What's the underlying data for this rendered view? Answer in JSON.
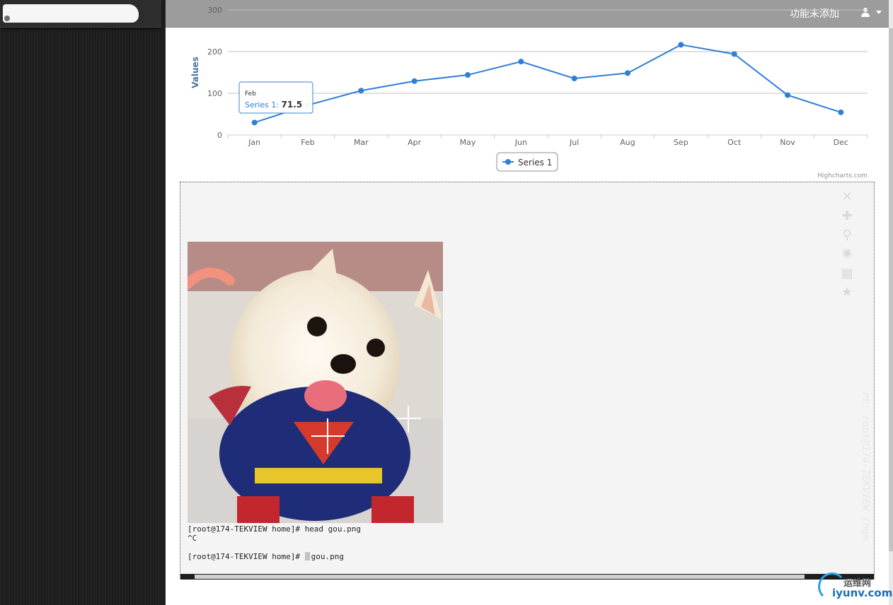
{
  "header": {
    "feature_label": "功能未添加"
  },
  "chart_data": {
    "type": "line",
    "categories": [
      "Jan",
      "Feb",
      "Mar",
      "Apr",
      "May",
      "Jun",
      "Jul",
      "Aug",
      "Sep",
      "Oct",
      "Nov",
      "Dec"
    ],
    "series": [
      {
        "name": "Series 1",
        "values": [
          29.9,
          71.5,
          106.4,
          129.2,
          144.0,
          176.0,
          135.6,
          148.5,
          216.4,
          194.1,
          95.6,
          54.4
        ]
      }
    ],
    "ylabel": "Values",
    "yticks": [
      0,
      100,
      200,
      300
    ],
    "ylim": [
      0,
      300
    ],
    "grid": true,
    "legend": "bottom-center",
    "color": "#2f7ed8",
    "tooltip": {
      "category": "Feb",
      "series": "Series 1",
      "value": "71.5"
    },
    "credit": "Highcharts.com"
  },
  "terminal": {
    "lines": [
      "[root@174-TEKVIEW home]# head gou.png",
      "^C",
      "",
      "[root@174-TEKVIEW home]# "
    ],
    "last_line_rest": "gou.png",
    "vertical_text": "rt: root@174-TEKVIEW /hom"
  },
  "toolbar_icons": [
    "close-icon",
    "plus-icon",
    "search-icon",
    "gear-icon",
    "grid-icon",
    "star-icon"
  ],
  "watermark": {
    "cn": "运维网",
    "en": "iyunv.com"
  }
}
